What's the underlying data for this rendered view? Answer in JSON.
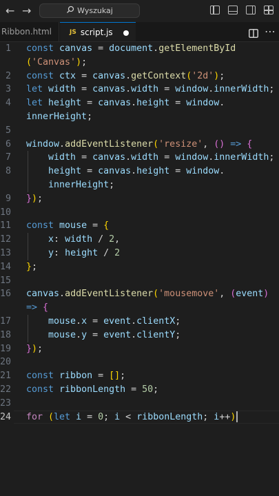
{
  "titlebar": {
    "back": "←",
    "forward": "→",
    "search_placeholder": "Wyszukaj"
  },
  "tabs": [
    {
      "label": "Ribbon.html",
      "active": false
    },
    {
      "label": "script.js",
      "active": true,
      "badge": "JS",
      "modified": true
    }
  ],
  "icons": {
    "search": "search-icon",
    "layouts": [
      "toggle-primary-sidebar-icon",
      "toggle-panel-icon",
      "toggle-secondary-sidebar-icon",
      "customize-layout-icon"
    ],
    "split": "split-editor-icon",
    "more": "more-actions-icon"
  },
  "colors": {
    "keyword": "#569cd6",
    "variable": "#9cdcfe",
    "function": "#dcdcaa",
    "string": "#ce9178",
    "number": "#b5cea8",
    "bracket_1": "#ffd700",
    "bracket_2": "#da70d6",
    "bracket_3": "#179fff"
  },
  "editor": {
    "current_line": "24",
    "lines": [
      {
        "n": "1",
        "t": [
          [
            "const ",
            "kw"
          ],
          [
            "canvas",
            "var"
          ],
          [
            " = "
          ],
          [
            "document",
            "var"
          ],
          [
            "."
          ],
          [
            "getElementById",
            "fn"
          ]
        ]
      },
      {
        "n": "",
        "t": [
          [
            "(",
            "b1"
          ],
          [
            "'Canvas'",
            "str"
          ],
          [
            ")",
            "b1"
          ],
          [
            ";"
          ]
        ]
      },
      {
        "n": "2",
        "t": [
          [
            "const ",
            "kw"
          ],
          [
            "ctx",
            "var"
          ],
          [
            " = "
          ],
          [
            "canvas",
            "var"
          ],
          [
            "."
          ],
          [
            "getContext",
            "fn"
          ],
          [
            "(",
            "b1"
          ],
          [
            "'2d'",
            "str"
          ],
          [
            ")",
            "b1"
          ],
          [
            ";"
          ]
        ]
      },
      {
        "n": "3",
        "t": [
          [
            "let ",
            "kw"
          ],
          [
            "width",
            "var"
          ],
          [
            " = "
          ],
          [
            "canvas",
            "var"
          ],
          [
            "."
          ],
          [
            "width",
            "var"
          ],
          [
            " = "
          ],
          [
            "window",
            "var"
          ],
          [
            "."
          ],
          [
            "innerWidth",
            "var"
          ],
          [
            ";"
          ]
        ]
      },
      {
        "n": "4",
        "t": [
          [
            "let ",
            "kw"
          ],
          [
            "height",
            "var"
          ],
          [
            " = "
          ],
          [
            "canvas",
            "var"
          ],
          [
            "."
          ],
          [
            "height",
            "var"
          ],
          [
            " = "
          ],
          [
            "window",
            "var"
          ],
          [
            "."
          ]
        ]
      },
      {
        "n": "",
        "t": [
          [
            "innerHeight",
            "var"
          ],
          [
            ";"
          ]
        ]
      },
      {
        "n": "5",
        "t": []
      },
      {
        "n": "6",
        "t": [
          [
            "window",
            "var"
          ],
          [
            "."
          ],
          [
            "addEventListener",
            "fn"
          ],
          [
            "(",
            "b1"
          ],
          [
            "'resize'",
            "str"
          ],
          [
            ", "
          ],
          [
            "()",
            "b2"
          ],
          [
            " "
          ],
          [
            "=>",
            "kw"
          ],
          [
            " "
          ],
          [
            "{",
            "b2"
          ]
        ]
      },
      {
        "n": "7",
        "t": [
          [
            "    "
          ],
          [
            "width",
            "var"
          ],
          [
            " = "
          ],
          [
            "canvas",
            "var"
          ],
          [
            "."
          ],
          [
            "width",
            "var"
          ],
          [
            " = "
          ],
          [
            "window",
            "var"
          ],
          [
            "."
          ],
          [
            "innerWidth",
            "var"
          ],
          [
            ";"
          ]
        ]
      },
      {
        "n": "8",
        "t": [
          [
            "    "
          ],
          [
            "height",
            "var"
          ],
          [
            " = "
          ],
          [
            "canvas",
            "var"
          ],
          [
            "."
          ],
          [
            "height",
            "var"
          ],
          [
            " = "
          ],
          [
            "window",
            "var"
          ],
          [
            "."
          ]
        ]
      },
      {
        "n": "",
        "t": [
          [
            "    "
          ],
          [
            "innerHeight",
            "var"
          ],
          [
            ";"
          ]
        ]
      },
      {
        "n": "9",
        "t": [
          [
            "}",
            "b2"
          ],
          [
            ")",
            "b1"
          ],
          [
            ";"
          ]
        ]
      },
      {
        "n": "10",
        "t": []
      },
      {
        "n": "11",
        "t": [
          [
            "const ",
            "kw"
          ],
          [
            "mouse",
            "var"
          ],
          [
            " = "
          ],
          [
            "{",
            "b1"
          ]
        ]
      },
      {
        "n": "12",
        "t": [
          [
            "    "
          ],
          [
            "x",
            "var"
          ],
          [
            ": "
          ],
          [
            "width",
            "var"
          ],
          [
            " / "
          ],
          [
            "2",
            "num"
          ],
          [
            ","
          ]
        ]
      },
      {
        "n": "13",
        "t": [
          [
            "    "
          ],
          [
            "y",
            "var"
          ],
          [
            ": "
          ],
          [
            "height",
            "var"
          ],
          [
            " / "
          ],
          [
            "2",
            "num"
          ]
        ]
      },
      {
        "n": "14",
        "t": [
          [
            "}",
            "b1"
          ],
          [
            ";"
          ]
        ]
      },
      {
        "n": "15",
        "t": []
      },
      {
        "n": "16",
        "t": [
          [
            "canvas",
            "var"
          ],
          [
            "."
          ],
          [
            "addEventListener",
            "fn"
          ],
          [
            "(",
            "b1"
          ],
          [
            "'mousemove'",
            "str"
          ],
          [
            ", "
          ],
          [
            "(",
            "b2"
          ],
          [
            "event",
            "var"
          ],
          [
            ")",
            "b2"
          ]
        ]
      },
      {
        "n": "",
        "t": [
          [
            "=>",
            "kw"
          ],
          [
            " "
          ],
          [
            "{",
            "b2"
          ]
        ]
      },
      {
        "n": "17",
        "t": [
          [
            "    "
          ],
          [
            "mouse",
            "var"
          ],
          [
            "."
          ],
          [
            "x",
            "var"
          ],
          [
            " = "
          ],
          [
            "event",
            "var"
          ],
          [
            "."
          ],
          [
            "clientX",
            "var"
          ],
          [
            ";"
          ]
        ]
      },
      {
        "n": "18",
        "t": [
          [
            "    "
          ],
          [
            "mouse",
            "var"
          ],
          [
            "."
          ],
          [
            "y",
            "var"
          ],
          [
            " = "
          ],
          [
            "event",
            "var"
          ],
          [
            "."
          ],
          [
            "clientY",
            "var"
          ],
          [
            ";"
          ]
        ]
      },
      {
        "n": "19",
        "t": [
          [
            "}",
            "b2"
          ],
          [
            ")",
            "b1"
          ],
          [
            ";"
          ]
        ]
      },
      {
        "n": "20",
        "t": []
      },
      {
        "n": "21",
        "t": [
          [
            "const ",
            "kw"
          ],
          [
            "ribbon",
            "var"
          ],
          [
            " = "
          ],
          [
            "[]",
            "b1"
          ],
          [
            ";"
          ]
        ]
      },
      {
        "n": "22",
        "t": [
          [
            "const ",
            "kw"
          ],
          [
            "ribbonLength",
            "var"
          ],
          [
            " = "
          ],
          [
            "50",
            "num"
          ],
          [
            ";"
          ]
        ]
      },
      {
        "n": "23",
        "t": []
      },
      {
        "n": "24",
        "t": [
          [
            "for ",
            "kw2"
          ],
          [
            "(",
            "b1"
          ],
          [
            "let ",
            "kw"
          ],
          [
            "i",
            "var"
          ],
          [
            " = "
          ],
          [
            "0",
            "num"
          ],
          [
            "; "
          ],
          [
            "i",
            "var"
          ],
          [
            " < "
          ],
          [
            "ribbonLength",
            "var"
          ],
          [
            "; "
          ],
          [
            "i",
            "var"
          ],
          [
            "++"
          ],
          [
            ")",
            "b1"
          ]
        ],
        "cursor": true
      },
      {
        "n": "",
        "t": []
      },
      {
        "n": "",
        "t": []
      },
      {
        "n": "",
        "t": []
      },
      {
        "n": "",
        "t": []
      },
      {
        "n": "",
        "t": []
      }
    ]
  }
}
